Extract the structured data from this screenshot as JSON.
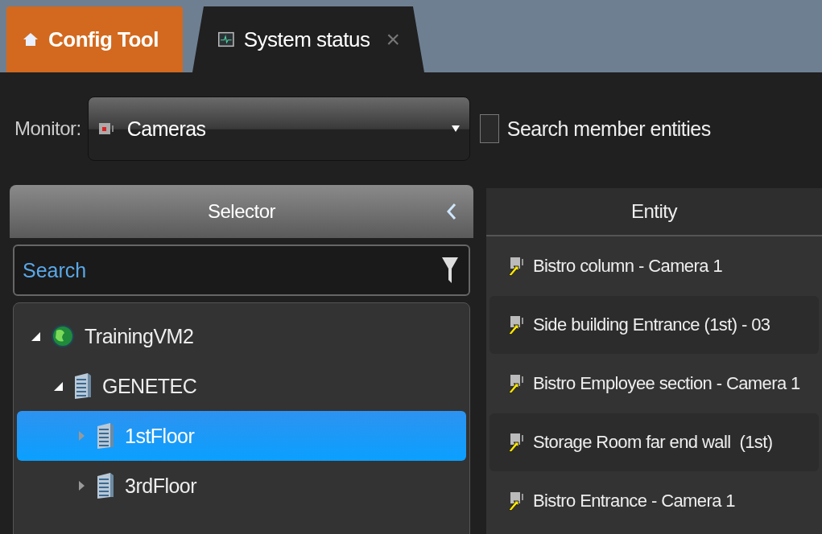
{
  "tabs": [
    {
      "label": "Config Tool",
      "kind": "home",
      "selected": false
    },
    {
      "label": "System status",
      "kind": "document",
      "selected": true,
      "close": "×"
    }
  ],
  "monitor": {
    "label": "Monitor:",
    "value": "Cameras"
  },
  "search_member_entities": {
    "label": "Search member entities",
    "checked": false
  },
  "selector": {
    "title": "Selector",
    "search": {
      "placeholder": "Search"
    },
    "tree": [
      {
        "label": "TrainingVM2",
        "kind": "server",
        "expanded": true,
        "selected": false,
        "children": [
          {
            "label": "GENETEC",
            "kind": "building",
            "expanded": true,
            "selected": false,
            "children": [
              {
                "label": "1stFloor",
                "kind": "building",
                "expanded": false,
                "selected": true
              },
              {
                "label": "3rdFloor",
                "kind": "building",
                "expanded": false,
                "selected": false
              }
            ]
          }
        ]
      }
    ]
  },
  "table": {
    "columns": [
      "Entity"
    ],
    "rows": [
      {
        "entity": "Bistro column - Camera 1"
      },
      {
        "entity": "Side building Entrance (1st) - 03"
      },
      {
        "entity": "Bistro Employee section - Camera 1"
      },
      {
        "entity": "Storage Room far end wall  (1st)"
      },
      {
        "entity": "Bistro Entrance - Camera 1"
      }
    ]
  }
}
